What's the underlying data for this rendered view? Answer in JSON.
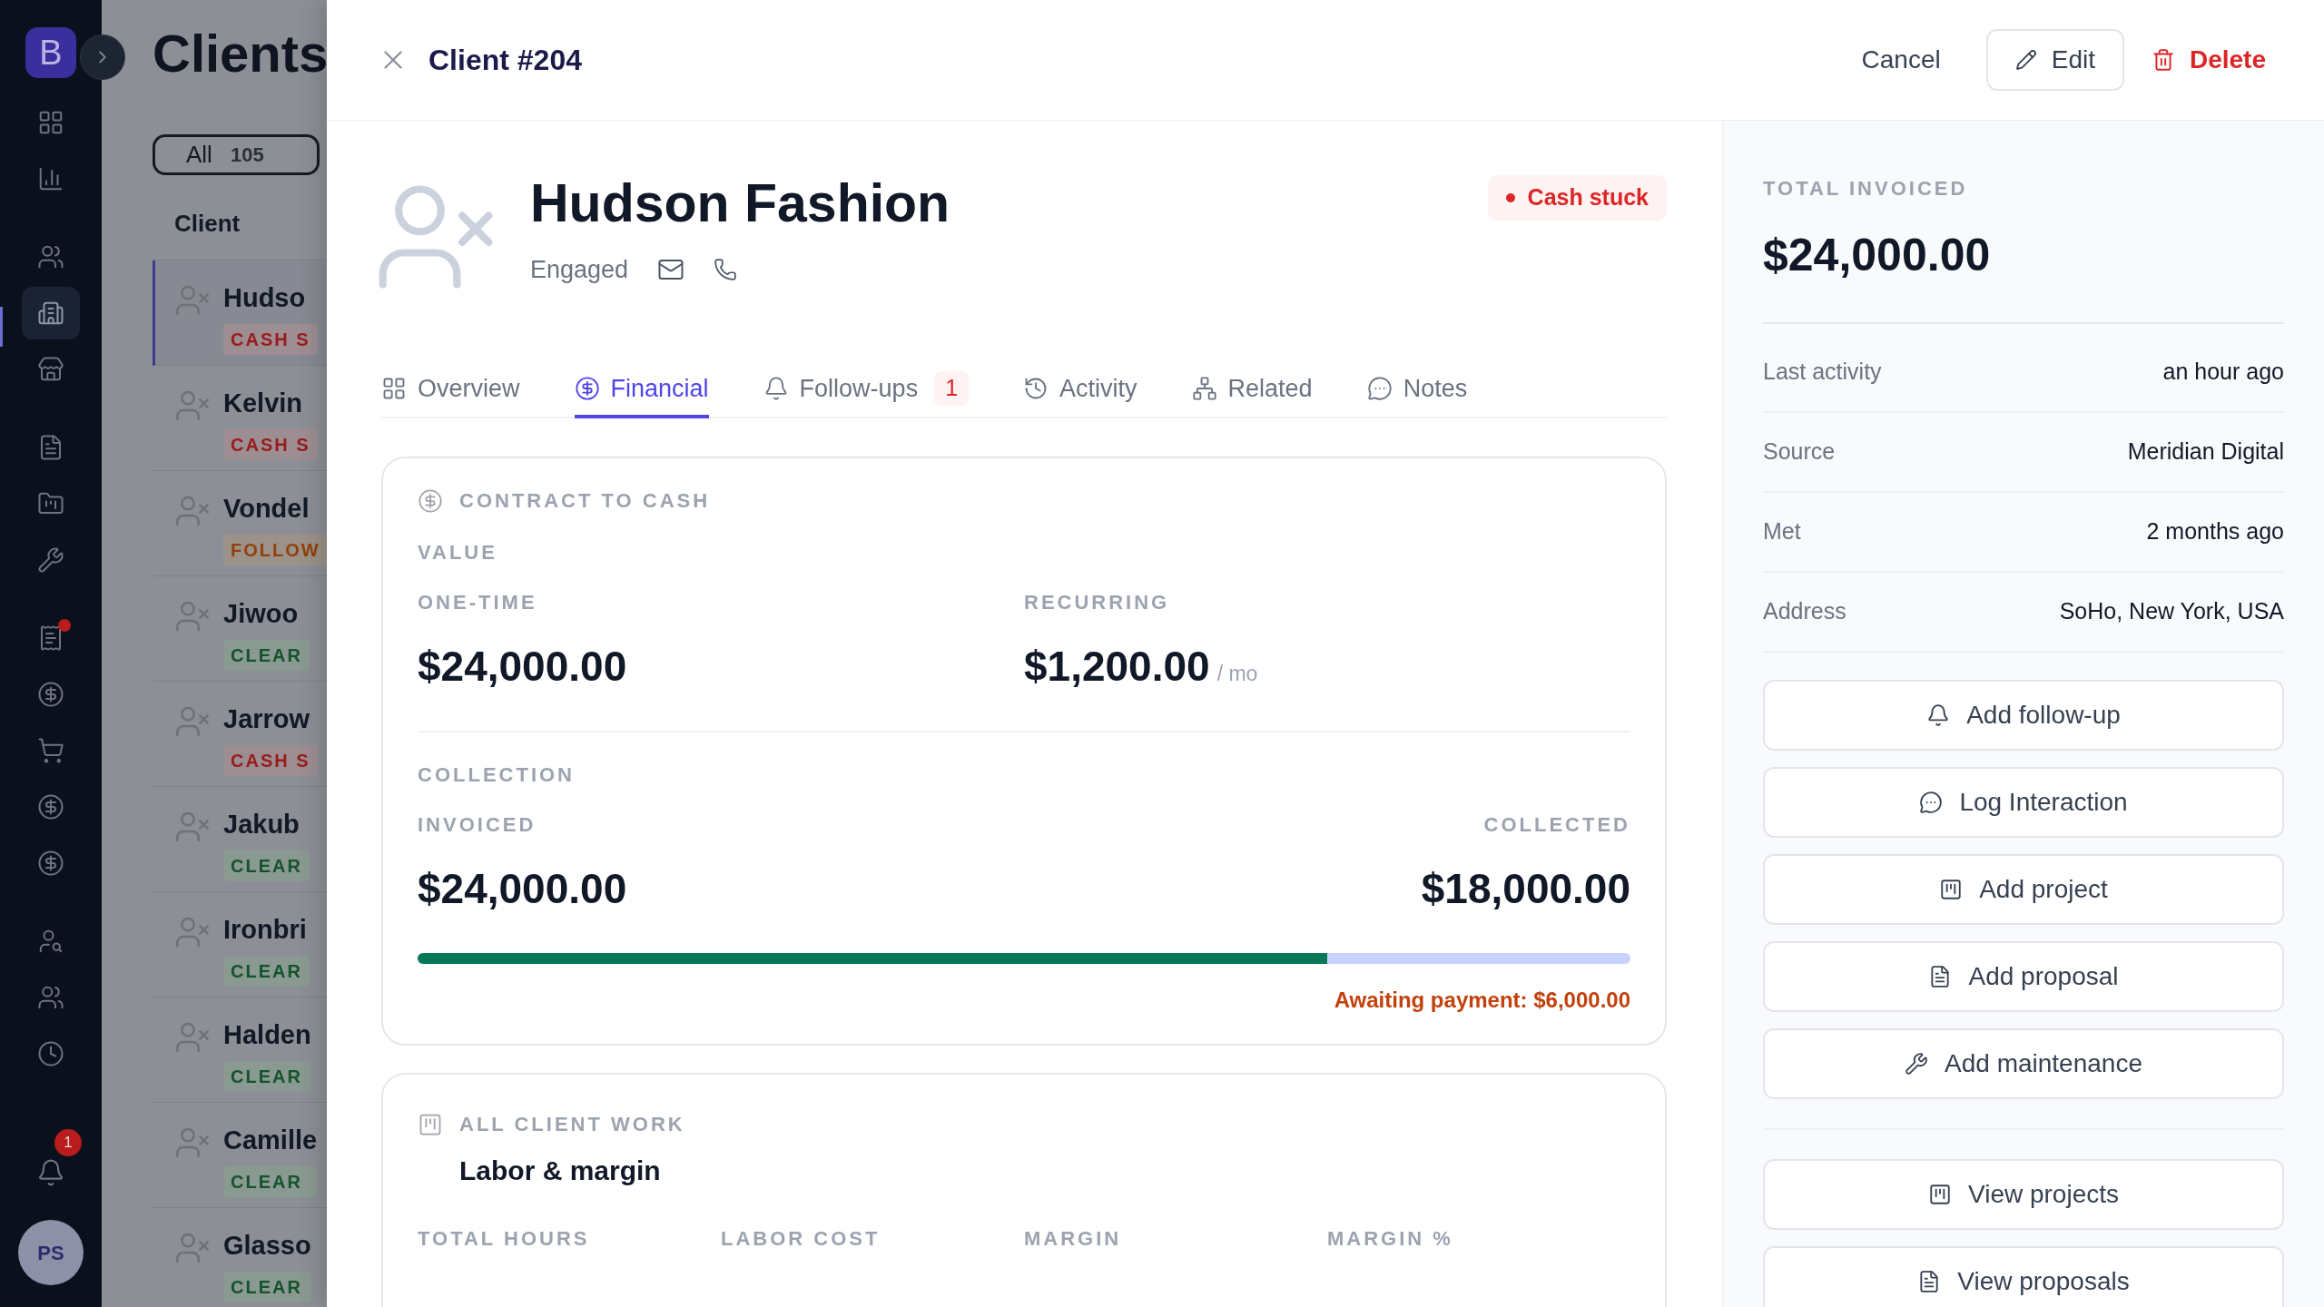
{
  "nav": {
    "logo": "B",
    "groups": [
      [
        {
          "selected": false,
          "dot": false
        },
        {
          "selected": false,
          "dot": false
        }
      ],
      [
        {
          "selected": false,
          "dot": false
        },
        {
          "selected": true,
          "dot": false
        },
        {
          "selected": false,
          "dot": false
        }
      ],
      [
        {
          "selected": false,
          "dot": false
        },
        {
          "selected": false,
          "dot": false
        },
        {
          "selected": false,
          "dot": false
        }
      ],
      [
        {
          "selected": false,
          "dot": true
        },
        {
          "selected": false,
          "dot": false
        },
        {
          "selected": false,
          "dot": false
        },
        {
          "selected": false,
          "dot": false
        },
        {
          "selected": false,
          "dot": false
        }
      ],
      [
        {
          "selected": false,
          "dot": false
        },
        {
          "selected": false,
          "dot": false
        },
        {
          "selected": false,
          "dot": false
        }
      ]
    ],
    "bell_badge": "1",
    "avatar": "PS"
  },
  "clients": {
    "title": "Clients",
    "filter": {
      "label": "All",
      "count": "105",
      "selected": true
    },
    "column": "Client",
    "rows": [
      {
        "name": "Hudso",
        "tag": "CASH S",
        "kind": "cash",
        "selected": true
      },
      {
        "name": "Kelvin",
        "tag": "CASH S",
        "kind": "cash",
        "selected": false
      },
      {
        "name": "Vondel",
        "tag": "FOLLOW",
        "kind": "follow",
        "selected": false
      },
      {
        "name": "Jiwoo",
        "tag": "CLEAR",
        "kind": "clear",
        "selected": false
      },
      {
        "name": "Jarrow",
        "tag": "CASH S",
        "kind": "cash",
        "selected": false
      },
      {
        "name": "Jakub",
        "tag": "CLEAR",
        "kind": "clear",
        "selected": false
      },
      {
        "name": "Ironbri",
        "tag": "CLEAR",
        "kind": "clear",
        "selected": false
      },
      {
        "name": "Halden",
        "tag": "CLEAR",
        "kind": "clear",
        "selected": false
      },
      {
        "name": "Camille",
        "tag": "CLEAR",
        "kind": "clear",
        "selected": false
      },
      {
        "name": "Glasso",
        "tag": "CLEAR",
        "kind": "clear",
        "selected": false
      }
    ]
  },
  "drawer": {
    "title": "Client #204",
    "cancel": "Cancel",
    "edit": "Edit",
    "delete": "Delete"
  },
  "profile": {
    "name": "Hudson Fashion",
    "stage": "Engaged",
    "badge": "Cash stuck"
  },
  "tabs": [
    {
      "label": "Overview",
      "selected": false
    },
    {
      "label": "Financial",
      "selected": true
    },
    {
      "label": "Follow-ups",
      "selected": false,
      "count": "1"
    },
    {
      "label": "Activity",
      "selected": false
    },
    {
      "label": "Related",
      "selected": false
    },
    {
      "label": "Notes",
      "selected": false
    }
  ],
  "contract": {
    "heading": "CONTRACT TO CASH",
    "value_label": "VALUE",
    "one_time_label": "ONE-TIME",
    "one_time": "$24,000.00",
    "recurring_label": "RECURRING",
    "recurring": "$1,200.00",
    "recurring_unit": "/ mo",
    "collection_label": "COLLECTION",
    "invoiced_label": "INVOICED",
    "invoiced": "$24,000.00",
    "collected_label": "COLLECTED",
    "collected": "$18,000.00",
    "level": 0.75,
    "awaiting": "Awaiting payment: $6,000.00"
  },
  "work": {
    "heading": "ALL CLIENT WORK",
    "title": "Labor & margin",
    "columns": [
      "TOTAL HOURS",
      "LABOR COST",
      "MARGIN",
      "MARGIN %"
    ]
  },
  "side": {
    "total_label": "TOTAL INVOICED",
    "total": "$24,000.00",
    "facts": [
      {
        "label": "Last activity",
        "value": "an hour ago"
      },
      {
        "label": "Source",
        "value": "Meridian Digital"
      },
      {
        "label": "Met",
        "value": "2 months ago"
      },
      {
        "label": "Address",
        "value": "SoHo, New York, USA"
      }
    ],
    "actions": [
      "Add follow-up",
      "Log Interaction",
      "Add project",
      "Add proposal",
      "Add maintenance"
    ],
    "views": [
      "View projects",
      "View proposals"
    ]
  }
}
